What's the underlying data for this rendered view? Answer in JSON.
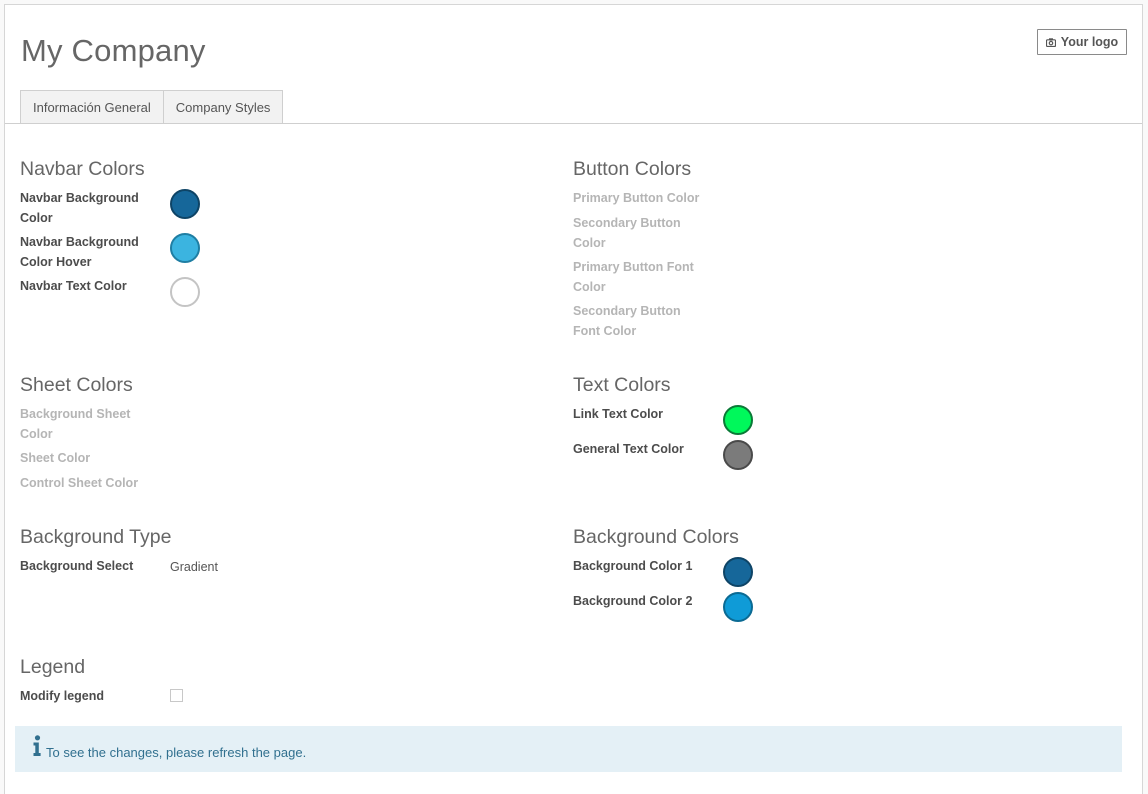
{
  "header": {
    "company_name": "My Company",
    "logo_button": "Your logo"
  },
  "tabs": [
    {
      "label": "Información General"
    },
    {
      "label": "Company Styles"
    }
  ],
  "sections": {
    "navbar": {
      "title": "Navbar Colors",
      "fields": [
        {
          "label": "Navbar Background Color",
          "color": "#16679a"
        },
        {
          "label": "Navbar Background Color Hover",
          "color": "#3bb4e0"
        },
        {
          "label": "Navbar Text Color",
          "color": "#ffffff"
        }
      ]
    },
    "button": {
      "title": "Button Colors",
      "fields": [
        {
          "label": "Primary Button Color"
        },
        {
          "label": "Secondary Button Color"
        },
        {
          "label": "Primary Button Font Color"
        },
        {
          "label": "Secondary Button Font Color"
        }
      ]
    },
    "sheet": {
      "title": "Sheet Colors",
      "fields": [
        {
          "label": "Background Sheet Color"
        },
        {
          "label": "Sheet Color"
        },
        {
          "label": "Control Sheet Color"
        }
      ]
    },
    "text": {
      "title": "Text Colors",
      "fields": [
        {
          "label": "Link Text Color",
          "color": "#00f85b"
        },
        {
          "label": "General Text Color",
          "color": "#7b7b7b"
        }
      ]
    },
    "background_type": {
      "title": "Background Type",
      "fields": [
        {
          "label": "Background Select",
          "value": "Gradient"
        }
      ]
    },
    "background_colors": {
      "title": "Background Colors",
      "fields": [
        {
          "label": "Background Color 1",
          "color": "#16679a"
        },
        {
          "label": "Background Color 2",
          "color": "#0f9bd7"
        }
      ]
    },
    "legend": {
      "title": "Legend",
      "fields": [
        {
          "label": "Modify legend",
          "checked": false
        }
      ]
    }
  },
  "alert": {
    "icon": "info-icon",
    "message": "To see the changes, please refresh the page."
  }
}
